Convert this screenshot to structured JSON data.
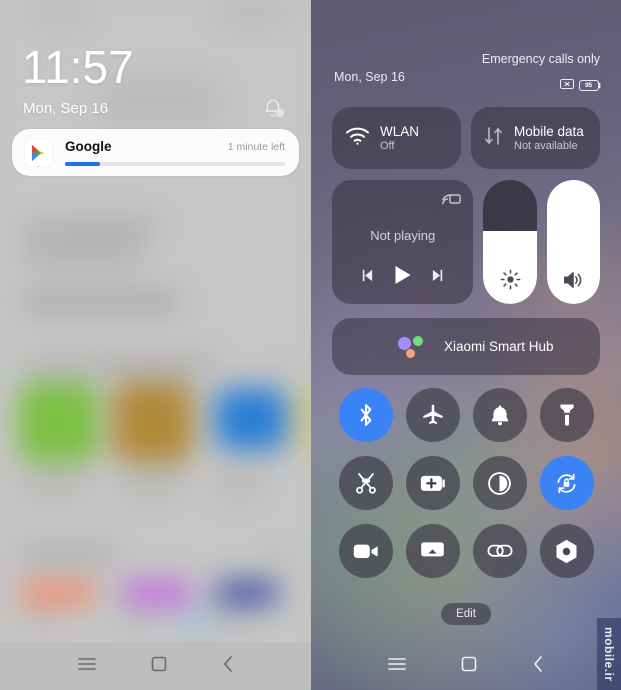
{
  "lockscreen": {
    "time": "11:57",
    "date": "Mon, Sep 16",
    "notification_settings_icon": "bell-gear-icon",
    "notification": {
      "app_icon": "google-play-icon",
      "title": "Google",
      "status": "1 minute left",
      "progress_percent": 16
    },
    "navbar": {
      "recents": "menu-icon",
      "home": "home-square-icon",
      "back": "back-chevron-icon"
    }
  },
  "control_center": {
    "status": {
      "carrier": "Emergency calls only",
      "date": "Mon, Sep 16",
      "sim_icon": "no-sim-icon",
      "battery_level": "95",
      "battery_icon": "battery-icon"
    },
    "connectivity_tiles": [
      {
        "icon": "wifi-icon",
        "title": "WLAN",
        "subtitle": "Off",
        "active": false
      },
      {
        "icon": "mobile-data-icon",
        "title": "Mobile data",
        "subtitle": "Not available",
        "active": false
      }
    ],
    "media": {
      "cast_icon": "cast-icon",
      "status": "Not playing",
      "previous_icon": "skip-previous-icon",
      "play_icon": "play-icon",
      "next_icon": "skip-next-icon"
    },
    "sliders": [
      {
        "name": "brightness",
        "icon": "sun-icon",
        "value_percent": 59
      },
      {
        "name": "volume",
        "icon": "volume-icon",
        "value_percent": 100
      }
    ],
    "smart_hub": {
      "icon": "xiaomi-hub-icon",
      "label": "Xiaomi Smart Hub",
      "dot_colors": [
        "#a78bfa",
        "#6ee07a",
        "#f8a07a"
      ]
    },
    "toggles": [
      {
        "icon": "bluetooth-icon",
        "name": "bluetooth",
        "active": true
      },
      {
        "icon": "airplane-icon",
        "name": "airplane-mode",
        "active": false
      },
      {
        "icon": "bell-icon",
        "name": "sound-mode",
        "active": false
      },
      {
        "icon": "flashlight-icon",
        "name": "flashlight",
        "active": false
      },
      {
        "icon": "scissors-icon",
        "name": "screenshot",
        "active": false
      },
      {
        "icon": "battery-plus-icon",
        "name": "battery-saver",
        "active": false
      },
      {
        "icon": "contrast-icon",
        "name": "dark-mode",
        "active": false
      },
      {
        "icon": "rotation-lock-icon",
        "name": "rotation-lock",
        "active": true
      },
      {
        "icon": "video-camera-icon",
        "name": "screen-recorder",
        "active": false
      },
      {
        "icon": "cast-screen-icon",
        "name": "cast",
        "active": false
      },
      {
        "icon": "link-icon",
        "name": "link",
        "active": false
      },
      {
        "icon": "settings-gear-icon",
        "name": "settings",
        "active": false
      }
    ],
    "edit_label": "Edit",
    "navbar": {
      "recents": "menu-icon",
      "home": "home-square-icon",
      "back": "back-chevron-icon"
    }
  },
  "watermark": {
    "text": "mobile.ir"
  },
  "colors": {
    "accent_blue": "#3b82f6",
    "progress_blue": "#1a73e8",
    "tile_bg": "rgba(52,48,62,.52)"
  }
}
